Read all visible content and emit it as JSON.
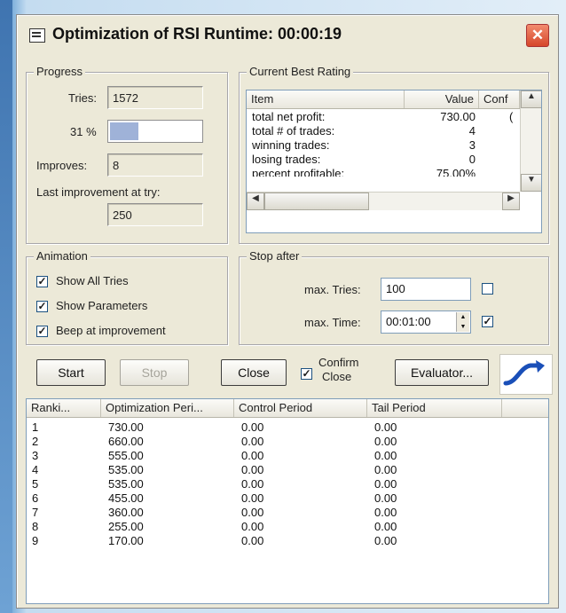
{
  "window": {
    "title": "Optimization of RSI Runtime: 00:00:19",
    "close_glyph": "✕"
  },
  "progress": {
    "legend": "Progress",
    "tries_label": "Tries:",
    "tries_value": "1572",
    "percent_label": "31 %",
    "percent_fraction": 0.31,
    "improves_label": "Improves:",
    "improves_value": "8",
    "last_improvement_label": "Last improvement at try:",
    "last_improvement_value": "250"
  },
  "best_rating": {
    "legend": "Current Best Rating",
    "columns": [
      "Item",
      "Value",
      "Conf"
    ],
    "rows": [
      {
        "item": "total net profit:",
        "value": "730.00",
        "conf": "("
      },
      {
        "item": "total # of trades:",
        "value": "4",
        "conf": ""
      },
      {
        "item": "winning trades:",
        "value": "3",
        "conf": ""
      },
      {
        "item": "losing trades:",
        "value": "0",
        "conf": ""
      },
      {
        "item": "percent profitable:",
        "value": "75.00%",
        "conf": ""
      }
    ]
  },
  "animation": {
    "legend": "Animation",
    "options": [
      {
        "label": "Show All Tries",
        "checked": true
      },
      {
        "label": "Show Parameters",
        "checked": true
      },
      {
        "label": "Beep at improvement",
        "checked": true
      }
    ]
  },
  "stop_after": {
    "legend": "Stop after",
    "max_tries_label": "max. Tries:",
    "max_tries_value": "100",
    "max_tries_checked": false,
    "max_time_label": "max. Time:",
    "max_time_value": "00:01:00",
    "max_time_checked": true
  },
  "buttons": {
    "start": "Start",
    "stop": "Stop",
    "close": "Close",
    "confirm_close_line1": "Confirm",
    "confirm_close_line2": "Close",
    "confirm_close_checked": true,
    "evaluator": "Evaluator..."
  },
  "results": {
    "columns": [
      "Ranki...",
      "Optimization Peri...",
      "Control Period",
      "Tail Period"
    ],
    "rows": [
      [
        "1",
        "730.00",
        "0.00",
        "0.00"
      ],
      [
        "2",
        "660.00",
        "0.00",
        "0.00"
      ],
      [
        "3",
        "555.00",
        "0.00",
        "0.00"
      ],
      [
        "4",
        "535.00",
        "0.00",
        "0.00"
      ],
      [
        "5",
        "535.00",
        "0.00",
        "0.00"
      ],
      [
        "6",
        "455.00",
        "0.00",
        "0.00"
      ],
      [
        "7",
        "360.00",
        "0.00",
        "0.00"
      ],
      [
        "8",
        "255.00",
        "0.00",
        "0.00"
      ],
      [
        "9",
        "170.00",
        "0.00",
        "0.00"
      ]
    ]
  },
  "colors": {
    "dialog_bg": "#ece9d8",
    "progress_fill": "#9fb2d8",
    "logo_blue": "#1a4fb8",
    "close_red": "#d6462a"
  }
}
